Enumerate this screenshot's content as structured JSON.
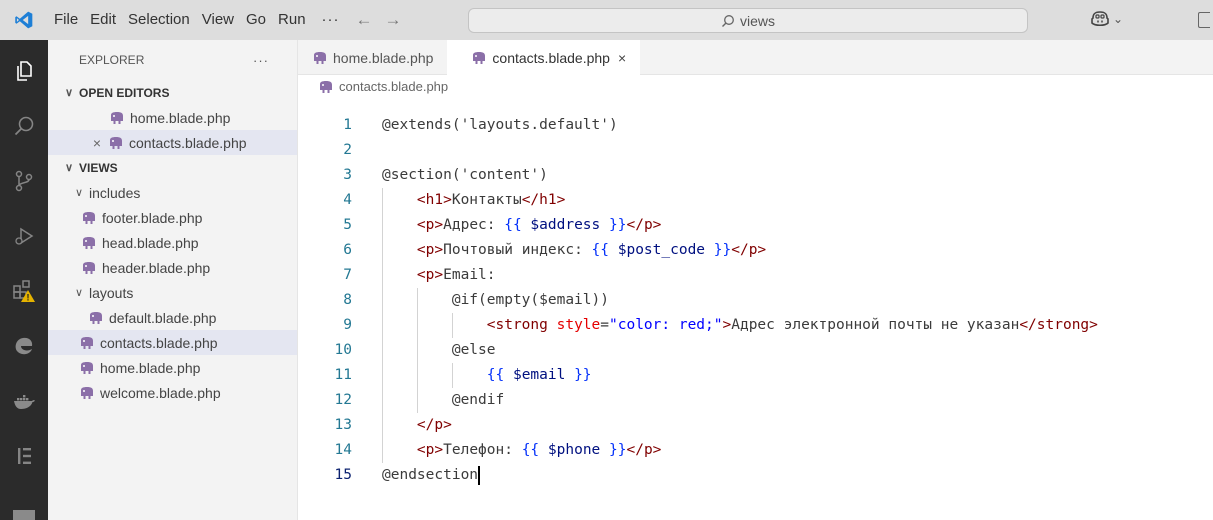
{
  "titlebar": {
    "menu": [
      "File",
      "Edit",
      "Selection",
      "View",
      "Go",
      "Run"
    ],
    "more": "···",
    "back_arrow": "←",
    "forward_arrow": "→",
    "search": "views",
    "copilot_caret": "⌄"
  },
  "activity_bar": [
    "explorer-icon",
    "search-icon",
    "source-control-icon",
    "run-debug-icon",
    "extensions-icon",
    "edge-icon",
    "docker-icon",
    "elementor-icon",
    "square-icon"
  ],
  "sidebar": {
    "title": "EXPLORER",
    "more": "···",
    "open_editors": {
      "label": "OPEN EDITORS",
      "items": [
        {
          "label": "home.blade.php"
        },
        {
          "label": "contacts.blade.php",
          "close": "×"
        }
      ]
    },
    "views": {
      "label": "VIEWS",
      "includes": {
        "label": "includes",
        "files": [
          "footer.blade.php",
          "head.blade.php",
          "header.blade.php"
        ]
      },
      "layouts": {
        "label": "layouts",
        "files": [
          "default.blade.php"
        ]
      },
      "files": [
        "contacts.blade.php",
        "home.blade.php",
        "welcome.blade.php"
      ]
    }
  },
  "tabs": [
    {
      "label": "home.blade.php",
      "active": false
    },
    {
      "label": "contacts.blade.php",
      "active": true,
      "close": "×"
    }
  ],
  "breadcrumb": "contacts.blade.php",
  "code": {
    "line_numbers": [
      "1",
      "2",
      "3",
      "4",
      "5",
      "6",
      "7",
      "8",
      "9",
      "10",
      "11",
      "12",
      "13",
      "14",
      "15"
    ],
    "current_line": 15,
    "lines": [
      [
        {
          "t": "@extends('layouts.default')",
          "c": "d"
        }
      ],
      [],
      [
        {
          "t": "@section('content')",
          "c": "d"
        }
      ],
      [
        {
          "t": "    ",
          "c": "d"
        },
        {
          "t": "<h1>",
          "c": "tg"
        },
        {
          "t": "Контакты",
          "c": "d"
        },
        {
          "t": "</h1>",
          "c": "tg"
        }
      ],
      [
        {
          "t": "    ",
          "c": "d"
        },
        {
          "t": "<p>",
          "c": "tg"
        },
        {
          "t": "Адрес: ",
          "c": "d"
        },
        {
          "t": "{{",
          "c": "br"
        },
        {
          "t": " $address ",
          "c": "vr"
        },
        {
          "t": "}}",
          "c": "br"
        },
        {
          "t": "</p>",
          "c": "tg"
        }
      ],
      [
        {
          "t": "    ",
          "c": "d"
        },
        {
          "t": "<p>",
          "c": "tg"
        },
        {
          "t": "Почтовый индекс: ",
          "c": "d"
        },
        {
          "t": "{{",
          "c": "br"
        },
        {
          "t": " $post_code ",
          "c": "vr"
        },
        {
          "t": "}}",
          "c": "br"
        },
        {
          "t": "</p>",
          "c": "tg"
        }
      ],
      [
        {
          "t": "    ",
          "c": "d"
        },
        {
          "t": "<p>",
          "c": "tg"
        },
        {
          "t": "Email:",
          "c": "d"
        }
      ],
      [
        {
          "t": "        @if(empty($email))",
          "c": "d"
        }
      ],
      [
        {
          "t": "            ",
          "c": "d"
        },
        {
          "t": "<strong ",
          "c": "tg"
        },
        {
          "t": "style",
          "c": "at"
        },
        {
          "t": "=",
          "c": "d"
        },
        {
          "t": "\"color: red;\"",
          "c": "av"
        },
        {
          "t": ">",
          "c": "tg"
        },
        {
          "t": "Адрес электронной почты не указан",
          "c": "d"
        },
        {
          "t": "</strong>",
          "c": "tg"
        }
      ],
      [
        {
          "t": "        @else",
          "c": "d"
        }
      ],
      [
        {
          "t": "            ",
          "c": "d"
        },
        {
          "t": "{{",
          "c": "br"
        },
        {
          "t": " $email ",
          "c": "vr"
        },
        {
          "t": "}}",
          "c": "br"
        }
      ],
      [
        {
          "t": "        @endif",
          "c": "d"
        }
      ],
      [
        {
          "t": "    ",
          "c": "d"
        },
        {
          "t": "</p>",
          "c": "tg"
        }
      ],
      [
        {
          "t": "    ",
          "c": "d"
        },
        {
          "t": "<p>",
          "c": "tg"
        },
        {
          "t": "Телефон: ",
          "c": "d"
        },
        {
          "t": "{{",
          "c": "br"
        },
        {
          "t": " $phone ",
          "c": "vr"
        },
        {
          "t": "}}",
          "c": "br"
        },
        {
          "t": "</p>",
          "c": "tg"
        }
      ],
      [
        {
          "t": "@endsection",
          "c": "d"
        }
      ]
    ]
  },
  "colors": {
    "elephant": "#8b6fa8",
    "accent": "#005fb8",
    "activity_bar": "#2b2b2b",
    "selection": "#e4e6f1"
  }
}
